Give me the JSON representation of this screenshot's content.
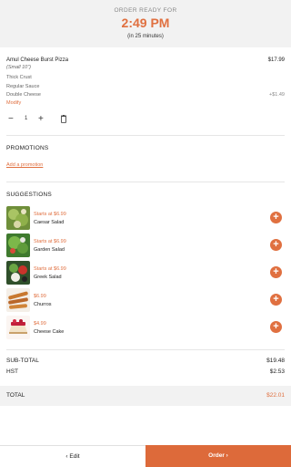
{
  "header": {
    "label": "ORDER READY FOR",
    "time": "2:49 PM",
    "eta": "(in 25 minutes)"
  },
  "cart_item": {
    "name": "Amul Cheese Burst Pizza",
    "size": "(Small 10\")",
    "price": "$17.99",
    "options": [
      "Thick Crust",
      "Regular Sauce",
      "Double Cheese"
    ],
    "option_extra_price": "+$1.49",
    "modify_label": "Modify",
    "quantity": "1"
  },
  "promotions": {
    "title": "PROMOTIONS",
    "add_label": "Add a promotion"
  },
  "suggestions": {
    "title": "SUGGESTIONS",
    "items": [
      {
        "price": "Starts at $6.99",
        "name": "Caesar Salad"
      },
      {
        "price": "Starts at $6.99",
        "name": "Garden Salad"
      },
      {
        "price": "Starts at $6.99",
        "name": "Greek Salad"
      },
      {
        "price": "$6.99",
        "name": "Churros"
      },
      {
        "price": "$4.99",
        "name": "Cheese Cake"
      }
    ]
  },
  "totals": {
    "subtotal_label": "SUB-TOTAL",
    "subtotal_value": "$19.48",
    "tax_label": "HST",
    "tax_value": "$2.53",
    "total_label": "TOTAL",
    "total_value": "$22.01"
  },
  "footer": {
    "edit_label": "Edit",
    "order_label": "Order"
  },
  "colors": {
    "accent": "#e07040",
    "header_bg": "#f2f2f2"
  },
  "icons": {
    "minus": "minus-icon",
    "plus": "plus-icon",
    "trash": "trash-icon",
    "add": "add-circle-icon",
    "back": "chevron-left-icon",
    "forward": "chevron-right-icon"
  }
}
